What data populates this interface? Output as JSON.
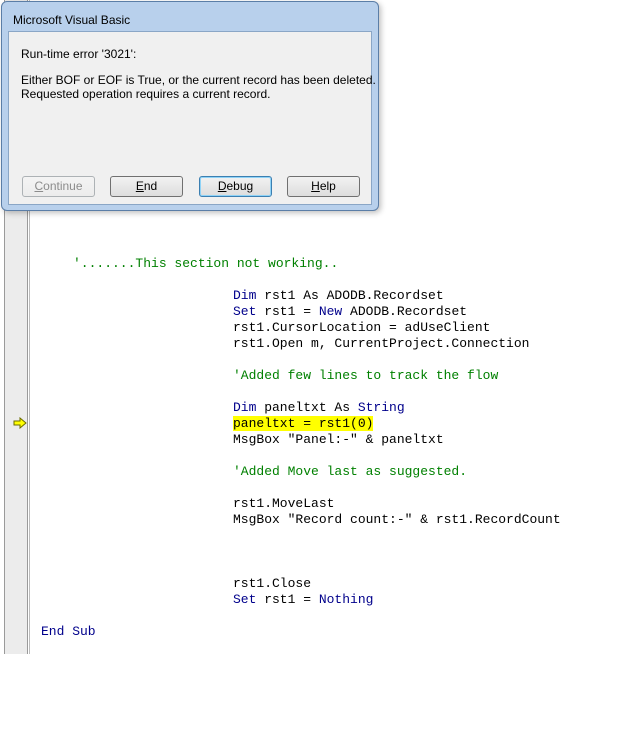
{
  "dialog": {
    "title": "Microsoft Visual Basic",
    "error_code": "Run-time error '3021':",
    "message_line1": "Either BOF or EOF is True, or the current record has been deleted.",
    "message_line2": "Requested operation requires a current record.",
    "buttons": {
      "continue": {
        "label": "Continue",
        "enabled": false
      },
      "end": {
        "label": "End",
        "enabled": true
      },
      "debug": {
        "label": "Debug",
        "enabled": true,
        "focused": true
      },
      "help": {
        "label": "Help",
        "enabled": true
      }
    }
  },
  "editor": {
    "execution_point_icon": "arrow-right-icon",
    "lines": {
      "comment_section": "'.......This section not working..",
      "dim_rst1": {
        "kw": "Dim",
        "rest": " rst1 As ADODB.Recordset"
      },
      "set_rst1": {
        "kw1": "Set",
        "mid": " rst1 = ",
        "kw2": "New",
        "rest": " ADODB.Recordset"
      },
      "cursor_location": "rst1.CursorLocation = adUseClient",
      "open": "rst1.Open m, CurrentProject.Connection",
      "comment_track": "'Added few lines to track the flow",
      "dim_paneltxt": {
        "kw": "Dim",
        "mid": " paneltxt As ",
        "kw2": "String"
      },
      "paneltxt_assign": "paneltxt = rst1(0)",
      "msgbox_panel": "MsgBox \"Panel:-\" & paneltxt",
      "comment_move": "'Added Move last as suggested.",
      "move_last": "rst1.MoveLast",
      "msgbox_count": "MsgBox \"Record count:-\" & rst1.RecordCount",
      "close": "rst1.Close",
      "set_nothing": {
        "kw": "Set",
        "mid": " rst1 = ",
        "kw2": "Nothing"
      },
      "end_sub": "End Sub"
    }
  },
  "colors": {
    "keyword": "#00008b",
    "comment": "#008000",
    "highlight": "#ffff00",
    "dialog_frame": "#b8d0ec"
  }
}
